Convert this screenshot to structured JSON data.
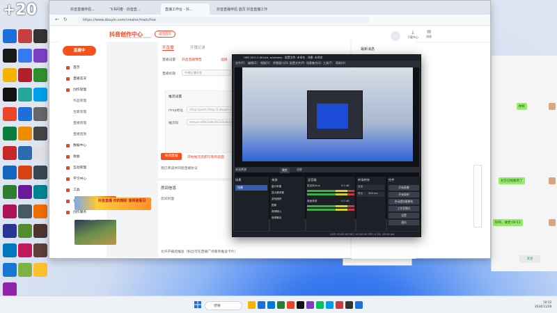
{
  "desktop": {
    "badge": "+20",
    "icon_colors": [
      "#1e6fd9",
      "#c43f3f",
      "#333",
      "#1a1a1a",
      "#3a7af0",
      "#7b3fc4",
      "#f4b400",
      "#b1202a",
      "#2f8f2f",
      "#111",
      "#26a69a",
      "#00a0e9",
      "#e8452a",
      "#1e6fd9",
      "#666",
      "#0b7d3e",
      "#f08c00",
      "#444",
      "#c62828",
      "#2b6cb0",
      "#e0e0e0",
      "#1565c0",
      "#d84315",
      "#37474f",
      "#2e7d32",
      "#6a1b9a",
      "#00838f",
      "#ad1457",
      "#455a64",
      "#ef6c00",
      "#283593",
      "#558b2f",
      "#4e342e",
      "#0277bd",
      "#c2185b",
      "#5d4037",
      "#1976d2",
      "#7cb342",
      "#fbc02d",
      "#8e24aa"
    ]
  },
  "browser": {
    "tabs": [
      "抖音直播伴侣...",
      "飞书问卷 · 抖音直...",
      "直播工作台 - 抖...",
      "抖音直播伴侣 首页 抖音直播工作..."
    ],
    "url": "https://www.douyin.com/creator/main/live",
    "logo": "抖音创作中心",
    "logo_sub": "DOUYIN CREATOR CENTER",
    "back_chip": "返回首页",
    "header": {
      "download": "下载中心",
      "messages": "消息"
    },
    "sidebar": {
      "live_button": "直播中",
      "items": [
        {
          "label": "首页",
          "sub": false
        },
        {
          "label": "直播实况",
          "sub": false
        },
        {
          "label": "创作管理",
          "sub": false
        },
        {
          "label": "作品管理",
          "sub": true
        },
        {
          "label": "合集管理",
          "sub": true
        },
        {
          "label": "直播管理",
          "sub": true
        },
        {
          "label": "直播回放",
          "sub": true
        },
        {
          "label": "数据中心",
          "sub": false
        },
        {
          "label": "收益",
          "sub": false
        },
        {
          "label": "互动管理",
          "sub": false
        },
        {
          "label": "学习中心",
          "sub": false
        },
        {
          "label": "工具",
          "sub": false
        },
        {
          "label": "合作",
          "sub": false
        },
        {
          "label": "创作服务",
          "sub": false
        }
      ]
    },
    "main": {
      "tabs": [
        "开直播",
        "开播记录"
      ],
      "fields": [
        {
          "label": "直播设置",
          "value": "开启直播预告",
          "note": "选择"
        },
        {
          "label": "直播标题",
          "value": "今晚正播开发"
        }
      ],
      "stream_section": "推流设置",
      "rtmp_label": "rtmp地址",
      "rtmp_value": "rtmp://push-rtmp-l1.douyin.com/live",
      "key_label": "推流码",
      "key_value": "stream-4f8c2e9a7b1d3c6e5a0f",
      "end_button": "关闭直播",
      "end_link": "开始推流后即可看到画面",
      "agree": "我已阅读并同意直播协议",
      "room_section": "房间信息",
      "room_label": "房间封面",
      "promo": "抖音直播 你的精彩 值得被看见",
      "thumb_caption": "精彩直播",
      "checkbox": "允许开播后推送（粉丝可在直播广场看到推送卡片）"
    },
    "right_panel": {
      "title": "最新消息"
    }
  },
  "obs": {
    "title": "OBS 28.0.2 (64-bit, windows) - 配置文件: 未命名 - 场景: 未命名",
    "menu": [
      "文件(F)",
      "编辑(E)",
      "视图(V)",
      "停靠窗口(D)",
      "配置文件(P)",
      "场景集合(S)",
      "工具(T)",
      "帮助(H)"
    ],
    "no_source": "未选择源",
    "mode_standard": "属性",
    "mode_studio": "滤镜",
    "docks": [
      "场景",
      "来源",
      "混音器",
      "转场特效",
      "控件"
    ],
    "scene": "场景",
    "sources": [
      "窗口采集",
      "显示器采集",
      "游戏捕获",
      "图像",
      "音频输入",
      "音频输出"
    ],
    "mixer": [
      {
        "name": "麦克风/Aux",
        "db": "0.0 dB"
      },
      {
        "name": "桌面音频",
        "db": "0.0 dB"
      }
    ],
    "transitions": [
      {
        "label": "淡出"
      },
      {
        "label": "时长",
        "value": "300 ms"
      }
    ],
    "controls": [
      "开始直播",
      "开始录制",
      "启动虚拟摄像机",
      "工作室模式",
      "设置",
      "退出"
    ],
    "status": "LIVE: 00:00:00   REC: 00:00:00   CPU: 0.3%, 60.00 fps"
  },
  "wechat": {
    "messages": [
      {
        "text": "你好"
      },
      {
        "text": "对方已经收到了"
      },
      {
        "text": "好的，收到 00:11"
      }
    ],
    "input_placeholder": "发送"
  },
  "taskbar": {
    "search": "搜索",
    "time": "10:12",
    "date": "2024/11/28"
  },
  "colors": {
    "accent": "#e8452a",
    "obs_bg": "#2b2e38",
    "wechat_bubble": "#95ec69"
  }
}
